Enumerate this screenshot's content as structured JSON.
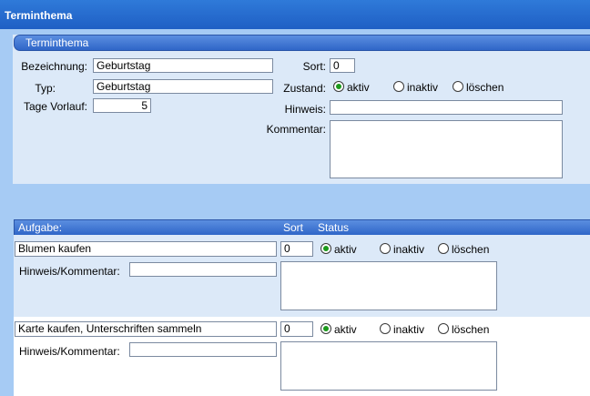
{
  "window": {
    "title": "Terminthema"
  },
  "theme_section": {
    "header": "Terminthema",
    "bezeichnung": {
      "label": "Bezeichnung:",
      "value": "Geburtstag"
    },
    "typ": {
      "label": "Typ:",
      "value": "Geburtstag"
    },
    "tage_vorlauf": {
      "label": "Tage Vorlauf:",
      "value": "5"
    },
    "sort": {
      "label": "Sort:",
      "value": "0"
    },
    "zustand": {
      "label": "Zustand:",
      "options": [
        "aktiv",
        "inaktiv",
        "löschen"
      ],
      "selected": "aktiv"
    },
    "hinweis": {
      "label": "Hinweis:",
      "value": ""
    },
    "kommentar": {
      "label": "Kommentar:",
      "value": ""
    }
  },
  "tasks_section": {
    "header": {
      "aufgabe": "Aufgabe:",
      "sort": "Sort",
      "status": "Status"
    },
    "hinweis_kommentar_label": "Hinweis/Kommentar:",
    "status_options": [
      "aktiv",
      "inaktiv",
      "löschen"
    ],
    "tasks": [
      {
        "aufgabe": "Blumen kaufen",
        "sort": "0",
        "status": "aktiv",
        "hinweis_kommentar": "",
        "notes": ""
      },
      {
        "aufgabe": "Karte kaufen, Unterschriften sammeln",
        "sort": "0",
        "status": "aktiv",
        "hinweis_kommentar": "",
        "notes": ""
      }
    ]
  },
  "colors": {
    "title_bar": "#1f5fc4",
    "panel_background": "#dce9f8",
    "window_background": "#a6cbf4",
    "radio_selected": "#1c9a1c"
  }
}
